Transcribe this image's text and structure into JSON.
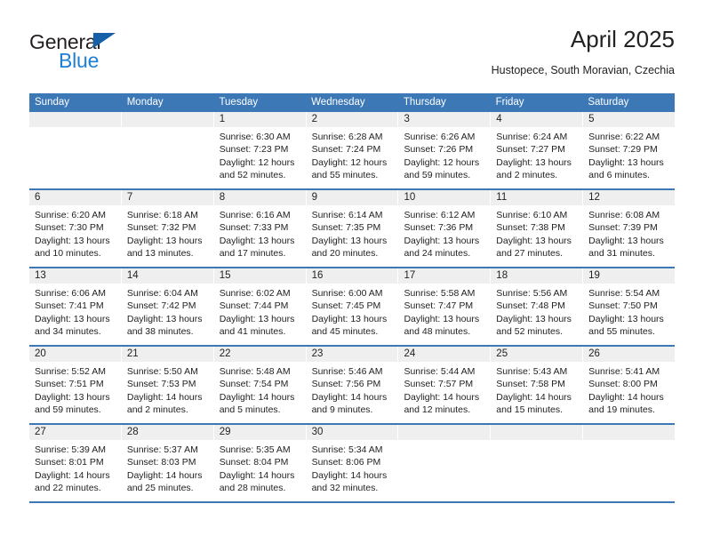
{
  "brand": {
    "name_top": "General",
    "name_bottom": "Blue",
    "triangle_icon": "triangle-icon",
    "color_dark": "#231f20",
    "color_blue": "#1f7fd4"
  },
  "header": {
    "title": "April 2025",
    "subtitle": "Hustopece, South Moravian, Czechia"
  },
  "theme": {
    "header_bg": "#3d78b6",
    "daynum_bg": "#efefef",
    "text": "#222222"
  },
  "weekdays": [
    "Sunday",
    "Monday",
    "Tuesday",
    "Wednesday",
    "Thursday",
    "Friday",
    "Saturday"
  ],
  "weeks": [
    [
      {
        "day": "",
        "sunrise": "",
        "sunset": "",
        "daylight": "",
        "empty": true
      },
      {
        "day": "",
        "sunrise": "",
        "sunset": "",
        "daylight": "",
        "empty": true
      },
      {
        "day": "1",
        "sunrise": "Sunrise: 6:30 AM",
        "sunset": "Sunset: 7:23 PM",
        "daylight": "Daylight: 12 hours and 52 minutes."
      },
      {
        "day": "2",
        "sunrise": "Sunrise: 6:28 AM",
        "sunset": "Sunset: 7:24 PM",
        "daylight": "Daylight: 12 hours and 55 minutes."
      },
      {
        "day": "3",
        "sunrise": "Sunrise: 6:26 AM",
        "sunset": "Sunset: 7:26 PM",
        "daylight": "Daylight: 12 hours and 59 minutes."
      },
      {
        "day": "4",
        "sunrise": "Sunrise: 6:24 AM",
        "sunset": "Sunset: 7:27 PM",
        "daylight": "Daylight: 13 hours and 2 minutes."
      },
      {
        "day": "5",
        "sunrise": "Sunrise: 6:22 AM",
        "sunset": "Sunset: 7:29 PM",
        "daylight": "Daylight: 13 hours and 6 minutes."
      }
    ],
    [
      {
        "day": "6",
        "sunrise": "Sunrise: 6:20 AM",
        "sunset": "Sunset: 7:30 PM",
        "daylight": "Daylight: 13 hours and 10 minutes."
      },
      {
        "day": "7",
        "sunrise": "Sunrise: 6:18 AM",
        "sunset": "Sunset: 7:32 PM",
        "daylight": "Daylight: 13 hours and 13 minutes."
      },
      {
        "day": "8",
        "sunrise": "Sunrise: 6:16 AM",
        "sunset": "Sunset: 7:33 PM",
        "daylight": "Daylight: 13 hours and 17 minutes."
      },
      {
        "day": "9",
        "sunrise": "Sunrise: 6:14 AM",
        "sunset": "Sunset: 7:35 PM",
        "daylight": "Daylight: 13 hours and 20 minutes."
      },
      {
        "day": "10",
        "sunrise": "Sunrise: 6:12 AM",
        "sunset": "Sunset: 7:36 PM",
        "daylight": "Daylight: 13 hours and 24 minutes."
      },
      {
        "day": "11",
        "sunrise": "Sunrise: 6:10 AM",
        "sunset": "Sunset: 7:38 PM",
        "daylight": "Daylight: 13 hours and 27 minutes."
      },
      {
        "day": "12",
        "sunrise": "Sunrise: 6:08 AM",
        "sunset": "Sunset: 7:39 PM",
        "daylight": "Daylight: 13 hours and 31 minutes."
      }
    ],
    [
      {
        "day": "13",
        "sunrise": "Sunrise: 6:06 AM",
        "sunset": "Sunset: 7:41 PM",
        "daylight": "Daylight: 13 hours and 34 minutes."
      },
      {
        "day": "14",
        "sunrise": "Sunrise: 6:04 AM",
        "sunset": "Sunset: 7:42 PM",
        "daylight": "Daylight: 13 hours and 38 minutes."
      },
      {
        "day": "15",
        "sunrise": "Sunrise: 6:02 AM",
        "sunset": "Sunset: 7:44 PM",
        "daylight": "Daylight: 13 hours and 41 minutes."
      },
      {
        "day": "16",
        "sunrise": "Sunrise: 6:00 AM",
        "sunset": "Sunset: 7:45 PM",
        "daylight": "Daylight: 13 hours and 45 minutes."
      },
      {
        "day": "17",
        "sunrise": "Sunrise: 5:58 AM",
        "sunset": "Sunset: 7:47 PM",
        "daylight": "Daylight: 13 hours and 48 minutes."
      },
      {
        "day": "18",
        "sunrise": "Sunrise: 5:56 AM",
        "sunset": "Sunset: 7:48 PM",
        "daylight": "Daylight: 13 hours and 52 minutes."
      },
      {
        "day": "19",
        "sunrise": "Sunrise: 5:54 AM",
        "sunset": "Sunset: 7:50 PM",
        "daylight": "Daylight: 13 hours and 55 minutes."
      }
    ],
    [
      {
        "day": "20",
        "sunrise": "Sunrise: 5:52 AM",
        "sunset": "Sunset: 7:51 PM",
        "daylight": "Daylight: 13 hours and 59 minutes."
      },
      {
        "day": "21",
        "sunrise": "Sunrise: 5:50 AM",
        "sunset": "Sunset: 7:53 PM",
        "daylight": "Daylight: 14 hours and 2 minutes."
      },
      {
        "day": "22",
        "sunrise": "Sunrise: 5:48 AM",
        "sunset": "Sunset: 7:54 PM",
        "daylight": "Daylight: 14 hours and 5 minutes."
      },
      {
        "day": "23",
        "sunrise": "Sunrise: 5:46 AM",
        "sunset": "Sunset: 7:56 PM",
        "daylight": "Daylight: 14 hours and 9 minutes."
      },
      {
        "day": "24",
        "sunrise": "Sunrise: 5:44 AM",
        "sunset": "Sunset: 7:57 PM",
        "daylight": "Daylight: 14 hours and 12 minutes."
      },
      {
        "day": "25",
        "sunrise": "Sunrise: 5:43 AM",
        "sunset": "Sunset: 7:58 PM",
        "daylight": "Daylight: 14 hours and 15 minutes."
      },
      {
        "day": "26",
        "sunrise": "Sunrise: 5:41 AM",
        "sunset": "Sunset: 8:00 PM",
        "daylight": "Daylight: 14 hours and 19 minutes."
      }
    ],
    [
      {
        "day": "27",
        "sunrise": "Sunrise: 5:39 AM",
        "sunset": "Sunset: 8:01 PM",
        "daylight": "Daylight: 14 hours and 22 minutes."
      },
      {
        "day": "28",
        "sunrise": "Sunrise: 5:37 AM",
        "sunset": "Sunset: 8:03 PM",
        "daylight": "Daylight: 14 hours and 25 minutes."
      },
      {
        "day": "29",
        "sunrise": "Sunrise: 5:35 AM",
        "sunset": "Sunset: 8:04 PM",
        "daylight": "Daylight: 14 hours and 28 minutes."
      },
      {
        "day": "30",
        "sunrise": "Sunrise: 5:34 AM",
        "sunset": "Sunset: 8:06 PM",
        "daylight": "Daylight: 14 hours and 32 minutes."
      },
      {
        "day": "",
        "sunrise": "",
        "sunset": "",
        "daylight": "",
        "empty": true
      },
      {
        "day": "",
        "sunrise": "",
        "sunset": "",
        "daylight": "",
        "empty": true
      },
      {
        "day": "",
        "sunrise": "",
        "sunset": "",
        "daylight": "",
        "empty": true
      }
    ]
  ]
}
